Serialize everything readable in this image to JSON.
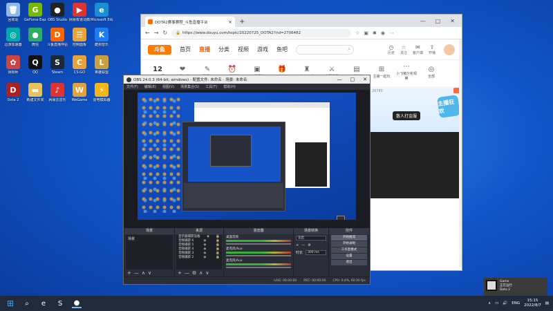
{
  "desktop": {
    "icons": [
      {
        "label": "回收站",
        "color": "#8fb8e6",
        "glyph": "🗑"
      },
      {
        "label": "GeForce Experience",
        "color": "#76b900",
        "glyph": "G"
      },
      {
        "label": "OBS Studio",
        "color": "#222",
        "glyph": "●"
      },
      {
        "label": "网易有道词典",
        "color": "#d33",
        "glyph": "▶"
      },
      {
        "label": "Microsoft Edge",
        "color": "#1b8fd2",
        "glyph": "e"
      },
      {
        "label": "迅游加速器",
        "color": "#0aa",
        "glyph": "◎"
      },
      {
        "label": "微信",
        "color": "#2aae67",
        "glyph": "●"
      },
      {
        "label": "斗鱼直播伴侣",
        "color": "#f60",
        "glyph": "D"
      },
      {
        "label": "控制面板",
        "color": "#e7a43a",
        "glyph": "☰"
      },
      {
        "label": "酷狗音乐",
        "color": "#1c7df0",
        "glyph": "K"
      },
      {
        "label": "阴阳师",
        "color": "#c44",
        "glyph": "✿"
      },
      {
        "label": "QQ",
        "color": "#111",
        "glyph": "Q"
      },
      {
        "label": "Steam",
        "color": "#1b2838",
        "glyph": "S"
      },
      {
        "label": "CS:GO",
        "color": "#e8a23a",
        "glyph": "C"
      },
      {
        "label": "英雄联盟",
        "color": "#c8a040",
        "glyph": "L"
      },
      {
        "label": "Dota 2",
        "color": "#a22",
        "glyph": "D"
      },
      {
        "label": "新建文件夹",
        "color": "#e7c15a",
        "glyph": "▬"
      },
      {
        "label": "网易云音乐",
        "color": "#d33",
        "glyph": "♪"
      },
      {
        "label": "WeGame",
        "color": "#e2a33a",
        "glyph": "W"
      },
      {
        "label": "雷电模拟器",
        "color": "#f2b61b",
        "glyph": "⚡"
      }
    ]
  },
  "browser": {
    "tab_title": "DOTA2赛事赛程_斗鱼直播平台",
    "new_tab": "+",
    "url": "https://www.douyu.com/topic/20220725_DOTA2?rid=2706482",
    "window_controls": [
      "—",
      "□",
      "✕"
    ],
    "site": {
      "logo": "斗鱼",
      "nav": [
        "首页",
        "直播",
        "分类",
        "视频",
        "游戏",
        "鱼吧"
      ],
      "active_nav": "直播",
      "right_items": [
        {
          "glyph": "◷",
          "label": "历史"
        },
        {
          "glyph": "☆",
          "label": "关注"
        },
        {
          "glyph": "✉",
          "label": "客户端"
        },
        {
          "glyph": "⇪",
          "label": "开播"
        }
      ],
      "categories": [
        {
          "glyph": "12",
          "label": "大厅日历"
        },
        {
          "glyph": "❤",
          "label": "直播工具"
        },
        {
          "glyph": "✎",
          "label": "情报站"
        },
        {
          "glyph": "⏰",
          "label": "开播提醒"
        },
        {
          "glyph": "▣",
          "label": "直播福利"
        },
        {
          "glyph": "🎁",
          "label": "礼物"
        },
        {
          "glyph": "♜",
          "label": "大力水手"
        },
        {
          "glyph": "⚔",
          "label": "全明星赛"
        },
        {
          "glyph": "▤",
          "label": "主播任务"
        },
        {
          "glyph": "⊞",
          "label": "主播一起玩"
        },
        {
          "glyph": "⋯",
          "label": "小飞猪分析观察"
        },
        {
          "glyph": "◎",
          "label": "全部"
        }
      ],
      "banner_id": "20780",
      "banner_button": "散人打金服",
      "banner_mascot": "主播狂欢"
    }
  },
  "obs": {
    "title": "OBS 24.0.3 (64-bit, windows) - 配置文件: 未命名 - 场景: 未命名",
    "menu": [
      "文件(F)",
      "编辑(E)",
      "视图(V)",
      "场景集合(S)",
      "工具(T)",
      "帮助(H)"
    ],
    "docks": {
      "scenes": {
        "header": "场景",
        "items": [
          "场景"
        ]
      },
      "sources": {
        "header": "来源",
        "items": [
          "显示器捕获设备",
          "音频捕获 6",
          "音频捕获 5",
          "音频捕获 4",
          "音频捕获 3",
          "音频捕获 2"
        ]
      },
      "mixer": {
        "header": "混音器",
        "rows": [
          "桌面音频",
          "麦克风/Aux",
          "麦克风/Aux"
        ]
      },
      "transitions": {
        "header": "场景转换",
        "mode": "淡出",
        "duration_label": "时长",
        "duration": "300 ms"
      },
      "controls": {
        "header": "控件",
        "buttons": [
          "开始推流",
          "开始录制",
          "工作室模式",
          "设置",
          "退出"
        ]
      }
    },
    "status": {
      "live": "LIVE: 00:00:00",
      "rec": "REC: 00:00:00",
      "cpu": "CPU: 0.4%, 60.00 fps"
    }
  },
  "toast": {
    "title": "Dota 2",
    "line1": "Game",
    "line2": "正在运行"
  },
  "taskbar": {
    "items": [
      {
        "glyph": "⊞",
        "name": "start"
      },
      {
        "glyph": "⌕",
        "name": "search"
      },
      {
        "glyph": "e",
        "name": "edge"
      },
      {
        "glyph": "S",
        "name": "steam"
      },
      {
        "glyph": "●",
        "name": "obs"
      }
    ],
    "lang": "ENG",
    "time": "15:15",
    "date": "2022/8/7"
  }
}
